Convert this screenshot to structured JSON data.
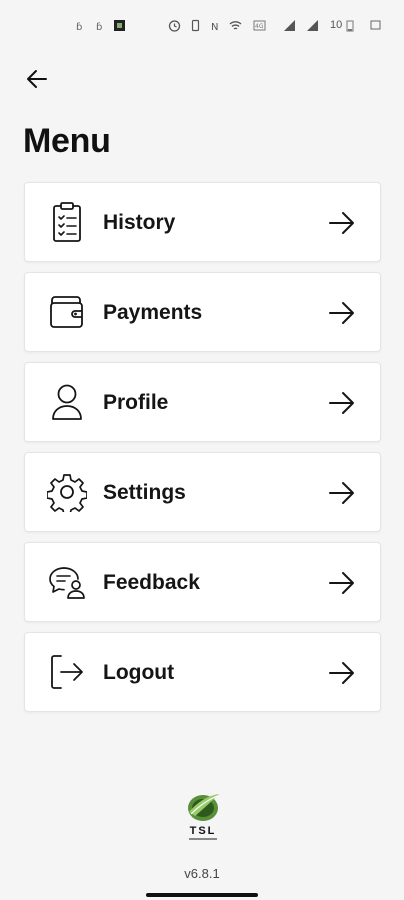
{
  "status_bar": {
    "left_icons": [
      "notification-icon",
      "notification-icon",
      "app-icon"
    ],
    "right_icons": [
      "alarm-icon",
      "vibrate-icon",
      "nfc-icon",
      "wifi-icon",
      "data-icon",
      "signal-icon",
      "signal-icon"
    ],
    "battery": "10"
  },
  "header": {
    "back_icon": "arrow-left-icon",
    "title": "Menu"
  },
  "menu": {
    "items": [
      {
        "label": "History",
        "icon": "clipboard-list-icon"
      },
      {
        "label": "Payments",
        "icon": "wallet-icon"
      },
      {
        "label": "Profile",
        "icon": "user-icon"
      },
      {
        "label": "Settings",
        "icon": "gear-icon"
      },
      {
        "label": "Feedback",
        "icon": "chat-user-icon"
      },
      {
        "label": "Logout",
        "icon": "logout-icon"
      }
    ],
    "arrow_icon": "arrow-right-icon"
  },
  "footer": {
    "logo_text": "TSL",
    "version": "v6.8.1"
  },
  "colors": {
    "background": "#f5f5f5",
    "card": "#ffffff",
    "text": "#141414",
    "logo_green": "#4e8c2b"
  }
}
